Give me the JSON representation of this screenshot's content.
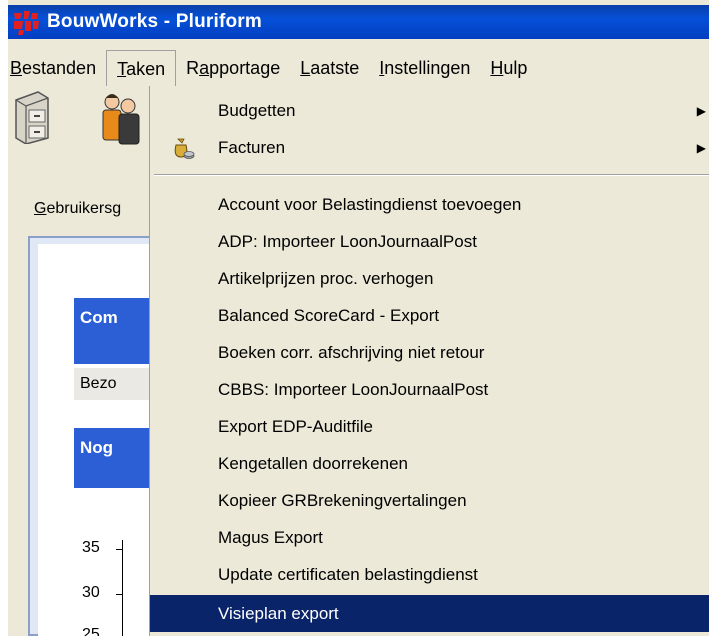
{
  "window": {
    "title": "BouwWorks - Pluriform",
    "title_bar_color": "#0550d8"
  },
  "menubar": {
    "items": [
      {
        "label": "Bestanden",
        "mnemonic": "B",
        "rest": "estanden"
      },
      {
        "label": "Taken",
        "mnemonic": "T",
        "rest": "aken"
      },
      {
        "label": "Rapportage",
        "pre": "R",
        "mnemonic": "a",
        "rest": "pportage"
      },
      {
        "label": "Laatste",
        "mnemonic": "L",
        "rest": "aatste"
      },
      {
        "label": "Instellingen",
        "mnemonic": "I",
        "rest": "nstellingen"
      },
      {
        "label": "Hulp",
        "mnemonic": "H",
        "rest": "ulp"
      }
    ]
  },
  "toolbar": {
    "icons": [
      "file-cabinet-icon",
      "users-icon"
    ]
  },
  "content": {
    "label_mnemonic": "G",
    "label_rest": "ebruikersg",
    "blue_header_1": "Com",
    "gray_row": "Bezo",
    "blue_header_2": "Nog",
    "axis_ticks": [
      "35",
      "30",
      "25"
    ]
  },
  "dropdown": {
    "submenus": [
      {
        "label": "Budgetten",
        "icon": "none"
      },
      {
        "label": "Facturen",
        "icon": "money-bag-icon"
      }
    ],
    "items": [
      "Account voor Belastingdienst toevoegen",
      "ADP: Importeer LoonJournaalPost",
      "Artikelprijzen proc. verhogen",
      "Balanced ScoreCard - Export",
      "Boeken corr. afschrijving niet retour",
      "CBBS: Importeer LoonJournaalPost",
      "Export EDP-Auditfile",
      "Kengetallen doorrekenen",
      "Kopieer GRBrekeningvertalingen",
      "Magus Export",
      "Update certificaten belastingdienst",
      "Visieplan export"
    ],
    "selected_index": 11,
    "highlight_color": "#0a246a"
  }
}
